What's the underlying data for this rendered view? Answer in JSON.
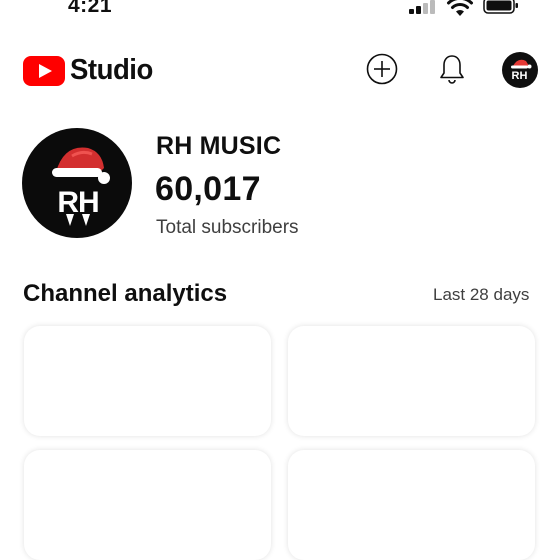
{
  "status_bar": {
    "time": "4:21"
  },
  "header": {
    "app_name": "Studio"
  },
  "channel": {
    "name": "RH MUSIC",
    "subscriber_count": "60,017",
    "subscriber_label": "Total subscribers",
    "avatar_initials": "RH"
  },
  "analytics": {
    "title": "Channel analytics",
    "period": "Last 28 days"
  },
  "colors": {
    "brand_red": "#ff0000",
    "text": "#0f0f0f",
    "secondary_text": "#3f3f3f"
  }
}
